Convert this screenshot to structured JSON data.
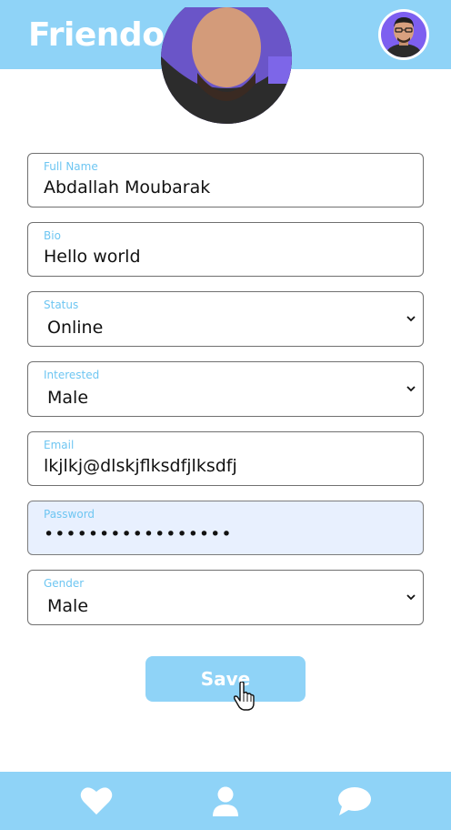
{
  "header": {
    "app_title": "Friendoo",
    "avatar_icon": "user-avatar"
  },
  "form": {
    "full_name": {
      "label": "Full Name",
      "value": "Abdallah Moubarak"
    },
    "bio": {
      "label": "Bio",
      "value": "Hello world"
    },
    "status": {
      "label": "Status",
      "value": "Online"
    },
    "interested": {
      "label": "Interested",
      "value": "Male"
    },
    "email": {
      "label": "Email",
      "value": "lkjlkj@dlskjflksdfjlksdfj"
    },
    "password": {
      "label": "Password",
      "value": "•••••••••••••••••"
    },
    "gender": {
      "label": "Gender",
      "value": "Male"
    }
  },
  "save_label": "Save",
  "bottom_nav": {
    "items": [
      "heart-icon",
      "profile-icon",
      "chat-icon"
    ]
  },
  "colors": {
    "accent": "#8fd3f7",
    "label": "#6ec6f2",
    "autofill": "#e8f0fe"
  }
}
